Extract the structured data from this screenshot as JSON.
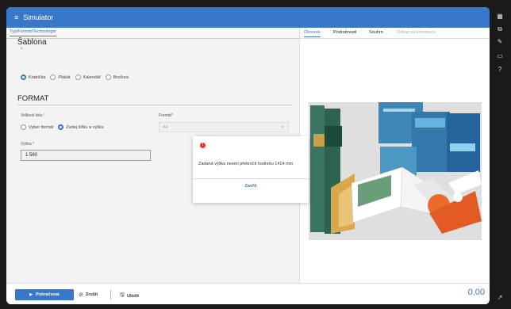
{
  "header": {
    "menu_icon": "hamburger-icon",
    "title": "Simulator"
  },
  "left_tab": "Typ/Formát/Technologie",
  "sablona": {
    "heading": "Šablona",
    "required_mark": "*",
    "options": [
      {
        "label": "Krabička",
        "selected": true
      },
      {
        "label": "Plakát",
        "selected": false
      },
      {
        "label": "Kalendář",
        "selected": false
      },
      {
        "label": "Brožura",
        "selected": false
      }
    ]
  },
  "format": {
    "heading": "FORMAT",
    "size_label": "Velikost listu",
    "size_options": [
      {
        "label": "Vyber formát",
        "selected": false
      },
      {
        "label": "Zadej šířku a výšku",
        "selected": true
      }
    ],
    "format_label": "Formát",
    "format_value": "A4",
    "height_label": "Výška",
    "height_value": "1 560",
    "required_mark": "*"
  },
  "dialog": {
    "icon": "error-icon",
    "message": "Zadaná výška nesmí překročit hodnotu 1414 mm",
    "close_label": "Zavřít"
  },
  "right_tabs": [
    {
      "label": "Obrázek",
      "state": "active"
    },
    {
      "label": "Podrobnosti",
      "state": "normal"
    },
    {
      "label": "Souhrn",
      "state": "normal"
    },
    {
      "label": "Odkaz na informace",
      "state": "muted"
    }
  ],
  "footer": {
    "continue_label": "Pokračovat",
    "cancel_label": "Zrušit",
    "save_label": "Uložit",
    "price": "0,00"
  },
  "side_icons": [
    "grid-icon",
    "copy-icon",
    "edit-icon",
    "inbox-icon",
    "help-icon",
    "external-link-icon"
  ],
  "colors": {
    "accent": "#3878c8",
    "error": "#d33333",
    "background": "#1a1a1a"
  }
}
